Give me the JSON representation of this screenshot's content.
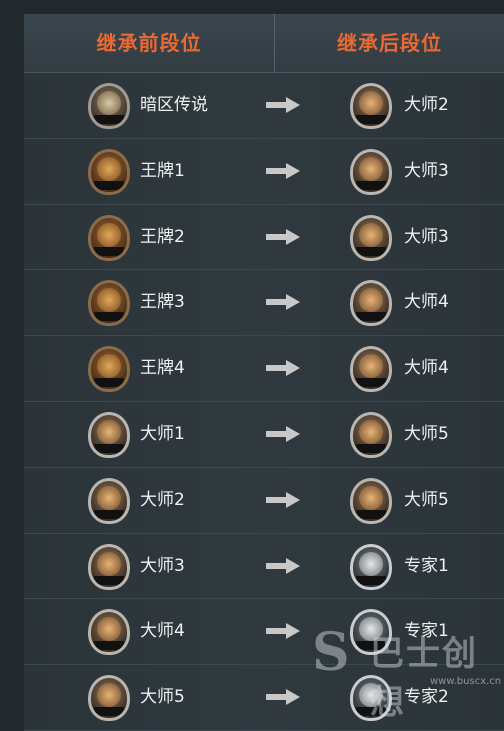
{
  "header": {
    "before_label": "继承前段位",
    "after_label": "继承后段位"
  },
  "rows": [
    {
      "before": {
        "label": "暗区传说",
        "icon": "legend-rank-badge-icon"
      },
      "after": {
        "label": "大师2",
        "icon": "master-rank-badge-icon"
      }
    },
    {
      "before": {
        "label": "王牌1",
        "icon": "ace-rank-badge-icon"
      },
      "after": {
        "label": "大师3",
        "icon": "master-rank-badge-icon"
      }
    },
    {
      "before": {
        "label": "王牌2",
        "icon": "ace-rank-badge-icon"
      },
      "after": {
        "label": "大师3",
        "icon": "master-rank-badge-icon"
      }
    },
    {
      "before": {
        "label": "王牌3",
        "icon": "ace-rank-badge-icon"
      },
      "after": {
        "label": "大师4",
        "icon": "master-rank-badge-icon"
      }
    },
    {
      "before": {
        "label": "王牌4",
        "icon": "ace-rank-badge-icon"
      },
      "after": {
        "label": "大师4",
        "icon": "master-rank-badge-icon"
      }
    },
    {
      "before": {
        "label": "大师1",
        "icon": "master-rank-badge-icon"
      },
      "after": {
        "label": "大师5",
        "icon": "master-rank-badge-icon"
      }
    },
    {
      "before": {
        "label": "大师2",
        "icon": "master-rank-badge-icon"
      },
      "after": {
        "label": "大师5",
        "icon": "master-rank-badge-icon"
      }
    },
    {
      "before": {
        "label": "大师3",
        "icon": "master-rank-badge-icon"
      },
      "after": {
        "label": "专家1",
        "icon": "expert-rank-badge-icon"
      }
    },
    {
      "before": {
        "label": "大师4",
        "icon": "master-rank-badge-icon"
      },
      "after": {
        "label": "专家1",
        "icon": "expert-rank-badge-icon"
      }
    },
    {
      "before": {
        "label": "大师5",
        "icon": "master-rank-badge-icon"
      },
      "after": {
        "label": "专家2",
        "icon": "expert-rank-badge-icon"
      }
    }
  ],
  "watermark": {
    "mark": "S",
    "text": "巴士创想",
    "url": "www.buscx.cn"
  },
  "colors": {
    "header_text": "#ea6a34",
    "arrow": "#c8c8c8",
    "row_text": "#f1f1f1"
  }
}
